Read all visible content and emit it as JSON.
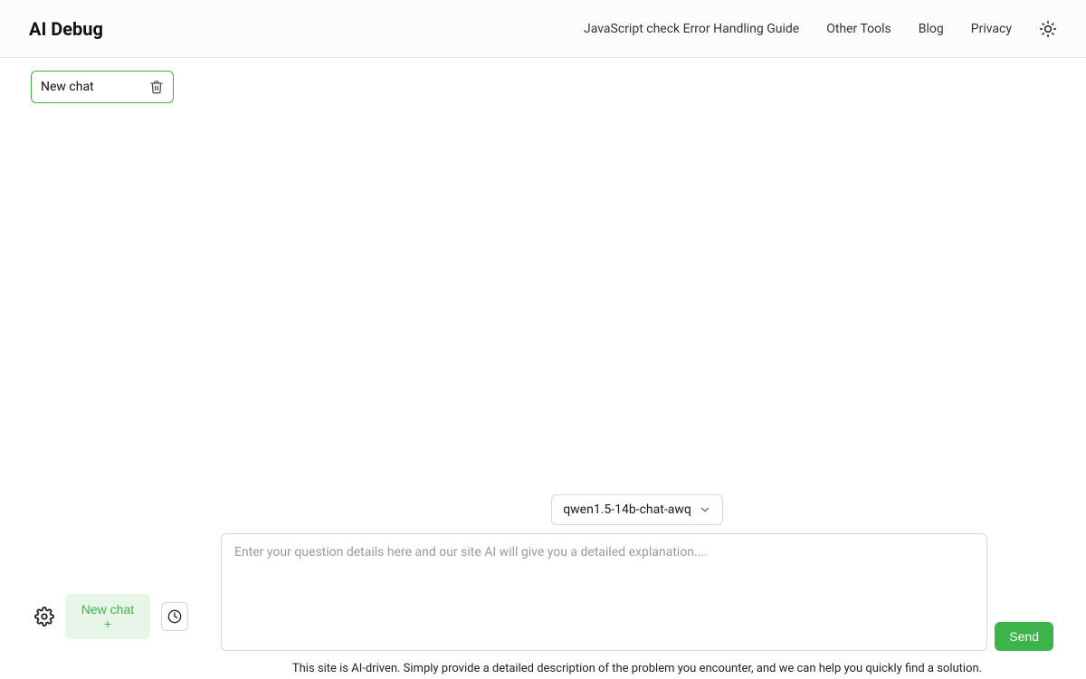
{
  "header": {
    "brand": "AI Debug",
    "links": [
      "JavaScript check Error Handling Guide",
      "Other Tools",
      "Blog",
      "Privacy"
    ]
  },
  "sidebar": {
    "current_chat_label": "New chat",
    "new_chat_button": "New chat +"
  },
  "composer": {
    "model_selected": "qwen1.5-14b-chat-awq",
    "placeholder": "Enter your question details here and our site AI will give you a detailed explanation....",
    "send_label": "Send"
  },
  "footer": {
    "disclaimer": "This site is AI-driven. Simply provide a detailed description of the problem you encounter, and we can help you quickly find a solution."
  }
}
